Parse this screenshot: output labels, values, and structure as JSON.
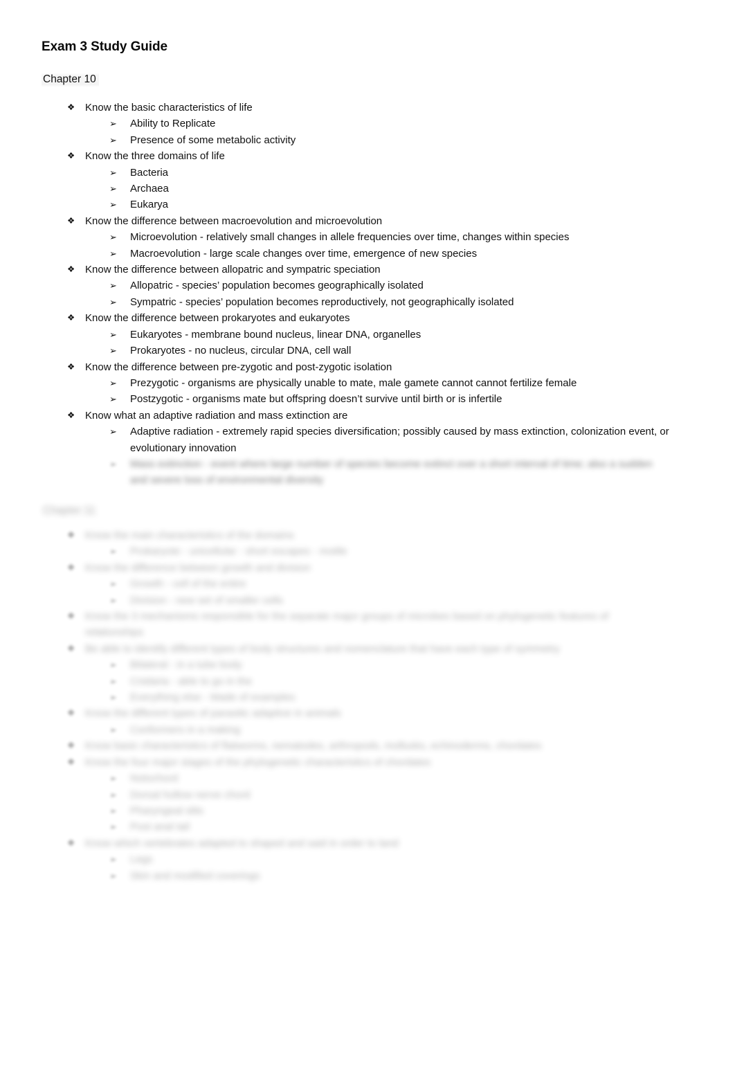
{
  "document": {
    "title": "Exam 3 Study Guide"
  },
  "sections": [
    {
      "heading": "Chapter 10",
      "redacted": false,
      "items": [
        {
          "level": 1,
          "bullet": "diamond-bullet-icon",
          "text": "Know the basic characteristics of life",
          "redacted": false
        },
        {
          "level": 2,
          "bullet": "arrow-bullet-icon",
          "text": "Ability to Replicate",
          "redacted": false
        },
        {
          "level": 2,
          "bullet": "arrow-bullet-icon",
          "text": "Presence of some metabolic activity",
          "redacted": false
        },
        {
          "level": 1,
          "bullet": "diamond-bullet-icon",
          "text": "Know the three domains of life",
          "redacted": false
        },
        {
          "level": 2,
          "bullet": "arrow-bullet-icon",
          "text": "Bacteria",
          "redacted": false
        },
        {
          "level": 2,
          "bullet": "arrow-bullet-icon",
          "text": "Archaea",
          "redacted": false
        },
        {
          "level": 2,
          "bullet": "arrow-bullet-icon",
          "text": "Eukarya",
          "redacted": false
        },
        {
          "level": 1,
          "bullet": "diamond-bullet-icon",
          "text": "Know the difference between macroevolution and microevolution",
          "redacted": false
        },
        {
          "level": 2,
          "bullet": "arrow-bullet-icon",
          "text": "Microevolution - relatively small changes in allele frequencies over time, changes within species",
          "redacted": false
        },
        {
          "level": 2,
          "bullet": "arrow-bullet-icon",
          "text": "Macroevolution - large scale changes over time, emergence of new species",
          "redacted": false
        },
        {
          "level": 1,
          "bullet": "diamond-bullet-icon",
          "text": "Know the difference between allopatric and sympatric speciation",
          "redacted": false
        },
        {
          "level": 2,
          "bullet": "arrow-bullet-icon",
          "text": "Allopatric - species’ population becomes geographically isolated",
          "redacted": false
        },
        {
          "level": 2,
          "bullet": "arrow-bullet-icon",
          "text": "Sympatric - species’ population becomes reproductively, not geographically isolated",
          "redacted": false
        },
        {
          "level": 1,
          "bullet": "diamond-bullet-icon",
          "text": "Know the difference between prokaryotes and eukaryotes",
          "redacted": false
        },
        {
          "level": 2,
          "bullet": "arrow-bullet-icon",
          "text": "Eukaryotes - membrane bound nucleus, linear DNA, organelles",
          "redacted": false
        },
        {
          "level": 2,
          "bullet": "arrow-bullet-icon",
          "text": "Prokaryotes - no nucleus, circular DNA, cell wall",
          "redacted": false
        },
        {
          "level": 1,
          "bullet": "diamond-bullet-icon",
          "text": "Know the difference between pre-zygotic and post-zygotic isolation",
          "redacted": false
        },
        {
          "level": 2,
          "bullet": "arrow-bullet-icon",
          "text": "Prezygotic - organisms are physically unable to mate, male gamete cannot cannot fertilize female",
          "redacted": false
        },
        {
          "level": 2,
          "bullet": "arrow-bullet-icon",
          "text": "Postzygotic - organisms mate but offspring doesn’t survive until birth or is infertile",
          "redacted": false
        },
        {
          "level": 1,
          "bullet": "diamond-bullet-icon",
          "text": "Know what an adaptive radiation and mass extinction are",
          "redacted": false
        },
        {
          "level": 2,
          "bullet": "arrow-bullet-icon",
          "text": "Adaptive radiation - extremely rapid species diversification; possibly caused by mass extinction, colonization event, or evolutionary innovation",
          "redacted": false
        },
        {
          "level": 2,
          "bullet": "arrow-bullet-icon",
          "text": "Mass extinction - event where large number of species become extinct over a short interval of time; also a sudden and severe loss of environmental diversity",
          "redacted": true
        }
      ]
    },
    {
      "heading": "Chapter 11",
      "redacted": true,
      "items": [
        {
          "level": 1,
          "bullet": "diamond-bullet-icon",
          "text": "Know the main characteristics of the domains",
          "redacted": true
        },
        {
          "level": 2,
          "bullet": "arrow-bullet-icon",
          "text": "Prokaryote - unicellular - short escapes - motile",
          "redacted": true
        },
        {
          "level": 1,
          "bullet": "diamond-bullet-icon",
          "text": "Know the difference between growth and division",
          "redacted": true
        },
        {
          "level": 2,
          "bullet": "arrow-bullet-icon",
          "text": "Growth - cell of the entire",
          "redacted": true
        },
        {
          "level": 2,
          "bullet": "arrow-bullet-icon",
          "text": "Division - new set of smaller cells",
          "redacted": true
        },
        {
          "level": 1,
          "bullet": "diamond-bullet-icon",
          "text": "Know the 3 mechanisms responsible for the separate major groups of microbes based on phylogenetic features of relationships",
          "redacted": true
        },
        {
          "level": 1,
          "bullet": "diamond-bullet-icon",
          "text": "Be able to identify different types of body structures and nomenclature that have each type of symmetry",
          "redacted": true
        },
        {
          "level": 2,
          "bullet": "arrow-bullet-icon",
          "text": "Bilateral - in a tube body",
          "redacted": true
        },
        {
          "level": 2,
          "bullet": "arrow-bullet-icon",
          "text": "Cnidaria - able to go in the",
          "redacted": true
        },
        {
          "level": 2,
          "bullet": "arrow-bullet-icon",
          "text": "Everything else - Made of examples",
          "redacted": true
        },
        {
          "level": 1,
          "bullet": "diamond-bullet-icon",
          "text": "Know the different types of parasitic adaptive in animals",
          "redacted": true
        },
        {
          "level": 2,
          "bullet": "arrow-bullet-icon",
          "text": "Conformers in a making",
          "redacted": true
        },
        {
          "level": 1,
          "bullet": "diamond-bullet-icon",
          "text": "Know basic characteristics of flatworms, nematodes, arthropods, mollusks, echinoderms, chordates",
          "redacted": true
        },
        {
          "level": 1,
          "bullet": "diamond-bullet-icon",
          "text": "Know the four major stages of the phylogenetic characteristics of chordates",
          "redacted": true
        },
        {
          "level": 2,
          "bullet": "arrow-bullet-icon",
          "text": "Notochord",
          "redacted": true
        },
        {
          "level": 2,
          "bullet": "arrow-bullet-icon",
          "text": "Dorsal hollow nerve chord",
          "redacted": true
        },
        {
          "level": 2,
          "bullet": "arrow-bullet-icon",
          "text": "Pharyngeal slits",
          "redacted": true
        },
        {
          "level": 2,
          "bullet": "arrow-bullet-icon",
          "text": "Post anal tail",
          "redacted": true
        },
        {
          "level": 1,
          "bullet": "diamond-bullet-icon",
          "text": "Know which vertebrates adapted to shaped and said in order to land",
          "redacted": true
        },
        {
          "level": 2,
          "bullet": "arrow-bullet-icon",
          "text": "Legs",
          "redacted": true
        },
        {
          "level": 2,
          "bullet": "arrow-bullet-icon",
          "text": "Skin and modified coverings",
          "redacted": true
        }
      ]
    }
  ]
}
